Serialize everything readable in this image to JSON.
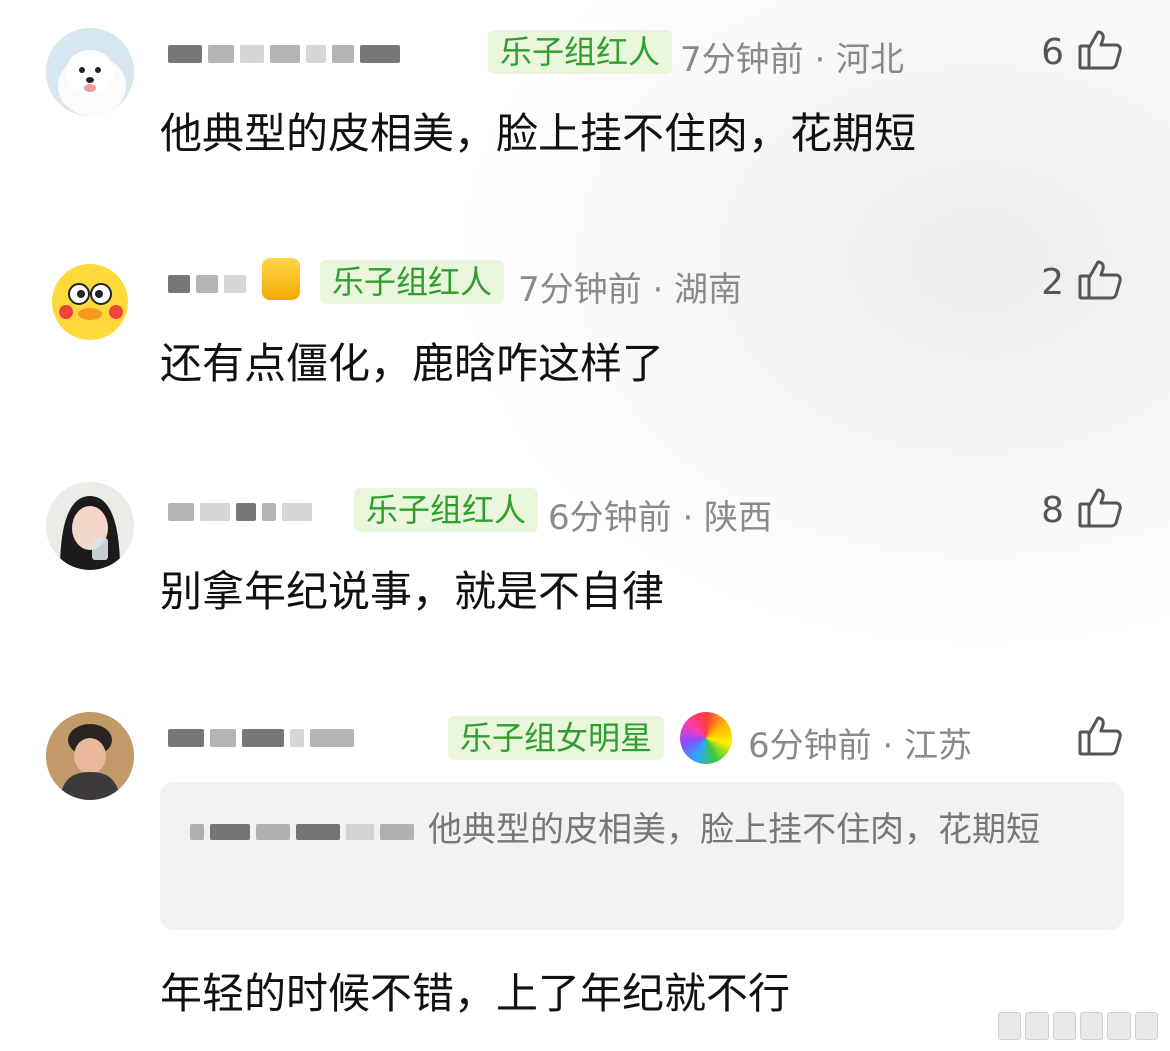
{
  "comments": [
    {
      "badge": "乐子组红人",
      "time_location": "7分钟前 · 河北",
      "likes": "6",
      "text": "他典型的皮相美，脸上挂不住肉，花期短"
    },
    {
      "badge": "乐子组红人",
      "time_location": "7分钟前 · 湖南",
      "likes": "2",
      "text": "还有点僵化，鹿晗咋这样了"
    },
    {
      "badge": "乐子组红人",
      "time_location": "6分钟前 · 陕西",
      "likes": "8",
      "text": "别拿年纪说事，就是不自律"
    },
    {
      "badge": "乐子组女明星",
      "time_location": "6分钟前 · 江苏",
      "likes": "",
      "quote": "他典型的皮相美，脸上挂不住肉，花期短",
      "text": "年轻的时候不错，上了年纪就不行"
    }
  ],
  "icons": {
    "like": "thumbs-up-icon",
    "vip": "gold-vip-icon",
    "medal": "rainbow-medal-icon"
  },
  "colors": {
    "badge_bg": "#e9f6dc",
    "badge_text": "#2f9e2f",
    "meta_text": "#8a8a8a",
    "body_text": "#111111",
    "quote_bg": "#f2f2f2"
  }
}
